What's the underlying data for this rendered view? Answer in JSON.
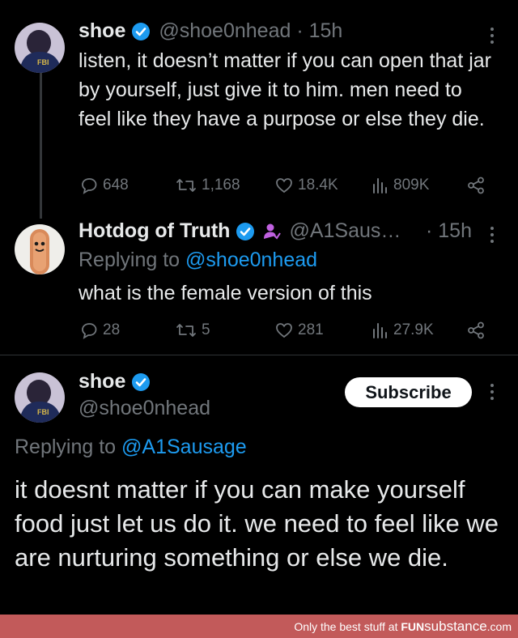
{
  "tweet1": {
    "name": "shoe",
    "handle": "@shoe0nhead · 15h",
    "text": "listen, it doesn’t matter if you can open that jar by yourself, just give it to him. men need to feel like they have a purpose or else they die.",
    "replies": "648",
    "reposts": "1,168",
    "likes": "18.4K",
    "views": "809K"
  },
  "tweet2": {
    "name": "Hotdog of Truth",
    "handle": "@A1Saus…",
    "time": "· 15h",
    "replying_prefix": "Replying to ",
    "replying_to": "@shoe0nhead",
    "text": "what is the female version of this",
    "replies": "28",
    "reposts": "5",
    "likes": "281",
    "views": "27.9K"
  },
  "tweet3": {
    "name": "shoe",
    "handle": "@shoe0nhead",
    "subscribe_label": "Subscribe",
    "replying_prefix": "Replying to ",
    "replying_to": "@A1Sausage",
    "text": "it doesnt matter if you can make yourself food just let us do it. we need to feel like we are nurturing something or else we die."
  },
  "footer": {
    "prefix": "Only the best stuff at ",
    "brand_bold": "FUN",
    "brand_rest": "substance",
    "suffix": ".com"
  },
  "colors": {
    "background": "#000000",
    "text": "#e7e9ea",
    "muted": "#71767b",
    "link": "#1d9bf0",
    "verified": "#1d9bf0",
    "footer": "#c25a5a"
  },
  "icons": [
    "reply-icon",
    "repost-icon",
    "like-icon",
    "views-icon",
    "share-icon",
    "verified-badge-icon",
    "more-icon",
    "affiliate-badge-icon"
  ]
}
